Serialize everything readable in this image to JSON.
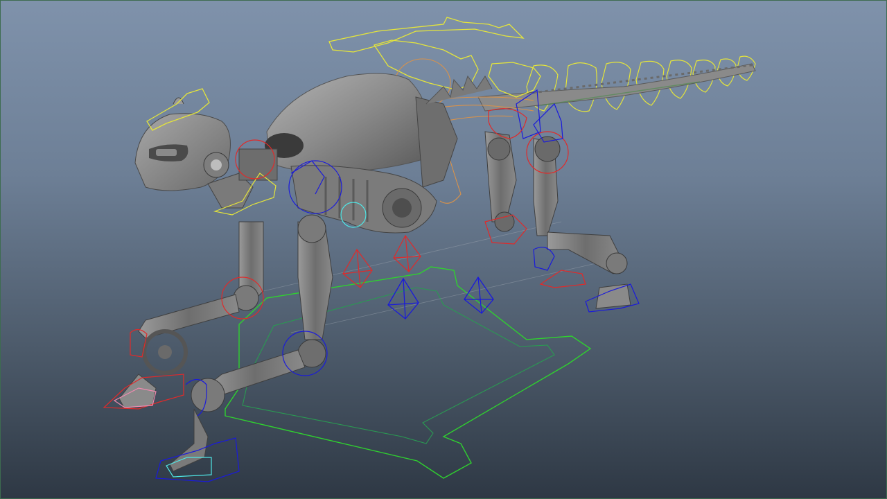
{
  "viewport": {
    "background_top": "#7f92ab",
    "background_bottom": "#2e3844",
    "border_color": "#3d6c50"
  },
  "scene": {
    "subject": "robotic-cat-rig",
    "mesh_color": "#8f8f8f",
    "mesh_dark": "#5f5f5f",
    "control_colors": {
      "yellow": "#e5e53a",
      "green": "#2fd12f",
      "red": "#e02a2a",
      "blue": "#1a1adb",
      "cyan": "#4fe6e6",
      "orange": "#d9924a",
      "pink": "#f08ab0"
    }
  }
}
